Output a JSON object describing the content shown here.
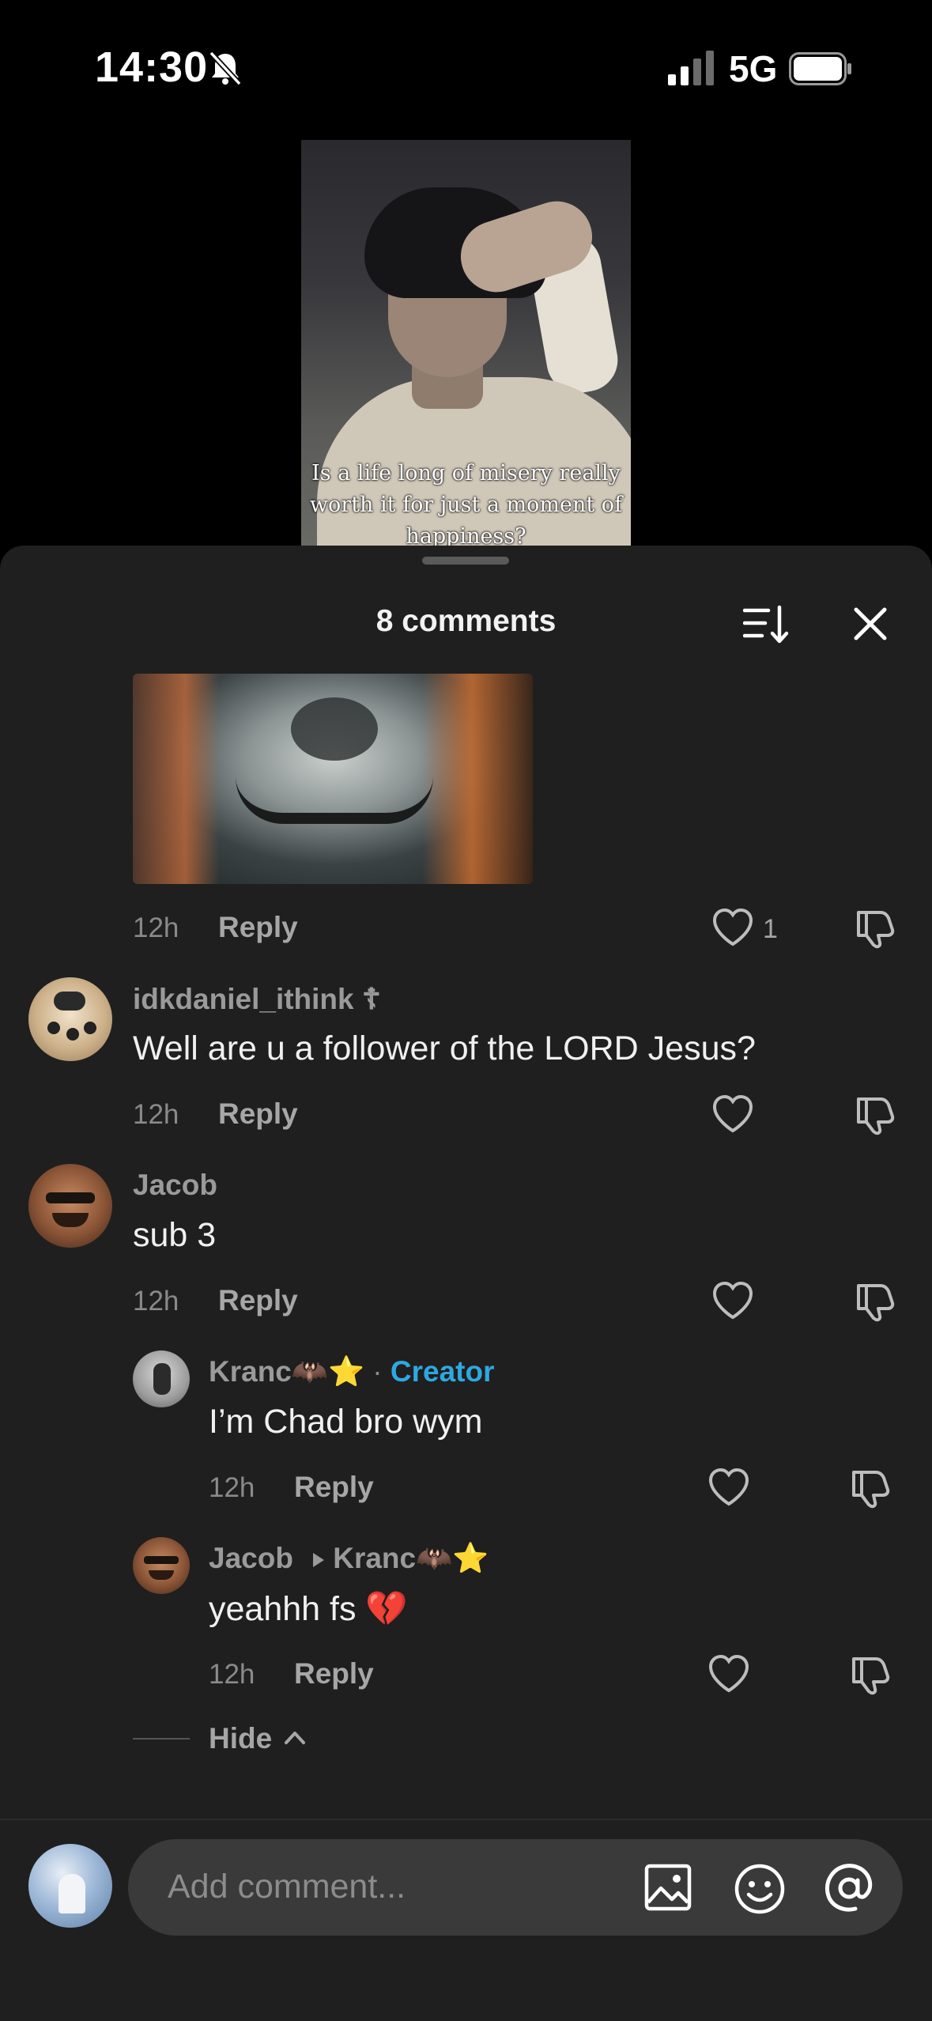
{
  "status_bar": {
    "time": "14:30",
    "network": "5G"
  },
  "video": {
    "caption": "Is a life long of misery really worth it for just a moment of happiness?"
  },
  "sheet": {
    "title": "8 comments"
  },
  "comments": [
    {
      "time": "12h",
      "reply_label": "Reply",
      "likes": "1"
    },
    {
      "username": "idkdaniel_ithink ☦",
      "text": "Well are u a follower of the LORD Jesus?",
      "time": "12h",
      "reply_label": "Reply"
    },
    {
      "username": "Jacob",
      "text": "sub 3",
      "time": "12h",
      "reply_label": "Reply",
      "replies": [
        {
          "username": "Kranc🦇⭐",
          "creator_sep": " · ",
          "creator_label": "Creator",
          "text": "I’m Chad bro wym",
          "time": "12h",
          "reply_label": "Reply"
        },
        {
          "username": "Jacob",
          "reply_to": "Kranc🦇⭐",
          "text": "yeahhh fs 💔",
          "time": "12h",
          "reply_label": "Reply"
        }
      ],
      "hide_label": "Hide"
    }
  ],
  "composer": {
    "placeholder": "Add comment..."
  },
  "icons": {
    "bell": "bell-slash-icon",
    "signal": "signal-icon",
    "battery": "battery-icon",
    "sort": "sort-icon",
    "close": "close-icon",
    "like": "heart-icon",
    "dislike": "thumbs-down-icon",
    "image": "image-icon",
    "emoji": "emoji-icon",
    "mention": "at-icon",
    "chevron": "chevron-up-icon"
  },
  "colors": {
    "creator": "#2ea8e0",
    "sheet_bg": "#1f1f1f"
  }
}
